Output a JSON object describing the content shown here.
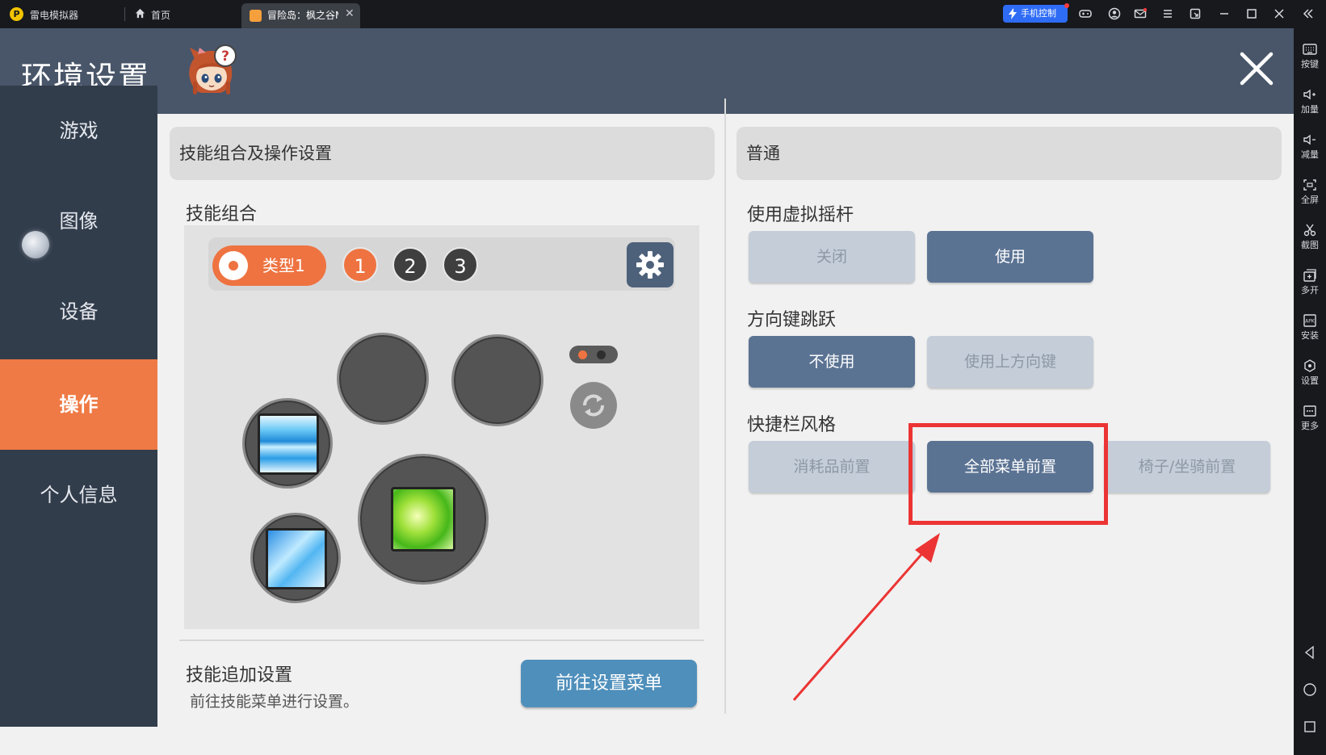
{
  "titlebar": {
    "app_name": "雷电模拟器",
    "home_label": "首页",
    "tab_label": "冒险岛：枫之谷M",
    "phone_control": "手机控制",
    "icons": [
      "gamepad-icon",
      "user-icon",
      "mail-icon",
      "menu-icon",
      "popout-icon",
      "minimize-icon",
      "maximize-icon",
      "close-icon",
      "collapse-icon"
    ]
  },
  "right_toolbar": {
    "items": [
      {
        "label": "按键",
        "icon": "keyboard-icon"
      },
      {
        "label": "加量",
        "icon": "volume-up-icon"
      },
      {
        "label": "减量",
        "icon": "volume-down-icon"
      },
      {
        "label": "全屏",
        "icon": "fullscreen-icon"
      },
      {
        "label": "截图",
        "icon": "scissors-icon"
      },
      {
        "label": "多开",
        "icon": "multi-instance-icon"
      },
      {
        "label": "安装",
        "icon": "apk-icon"
      },
      {
        "label": "设置",
        "icon": "settings-icon"
      },
      {
        "label": "更多",
        "icon": "more-icon"
      }
    ],
    "nav": [
      "back-icon",
      "home-icon",
      "recent-apps-icon"
    ]
  },
  "window": {
    "title": "环境设置"
  },
  "sidebar": {
    "items": [
      {
        "label": "游戏"
      },
      {
        "label": "图像"
      },
      {
        "label": "设备"
      },
      {
        "label": "操作",
        "active": true
      },
      {
        "label": "个人信息"
      }
    ]
  },
  "left_panel": {
    "header": "技能组合及操作设置",
    "skill_combo_label": "技能组合",
    "type_label": "类型1",
    "numbers": [
      "1",
      "2",
      "3"
    ],
    "active_number": "1",
    "extra_title": "技能追加设置",
    "extra_desc": "前往技能菜单进行设置。",
    "goto_button": "前往设置菜单"
  },
  "right_panel": {
    "header": "普通",
    "joystick": {
      "label": "使用虚拟摇杆",
      "options": [
        "关闭",
        "使用"
      ],
      "selected": "使用"
    },
    "jump": {
      "label": "方向键跳跃",
      "options": [
        "不使用",
        "使用上方向键"
      ],
      "selected": "不使用"
    },
    "quickbar": {
      "label": "快捷栏风格",
      "options": [
        "消耗品前置",
        "全部菜单前置",
        "椅子/坐骑前置"
      ],
      "selected": "全部菜单前置"
    }
  },
  "colors": {
    "accent": "#ef7a45",
    "header": "#495669",
    "sidebar": "#323d4c",
    "button_on": "#5b7393",
    "button_off": "#c4cdd8",
    "annotation": "#ec3434"
  }
}
